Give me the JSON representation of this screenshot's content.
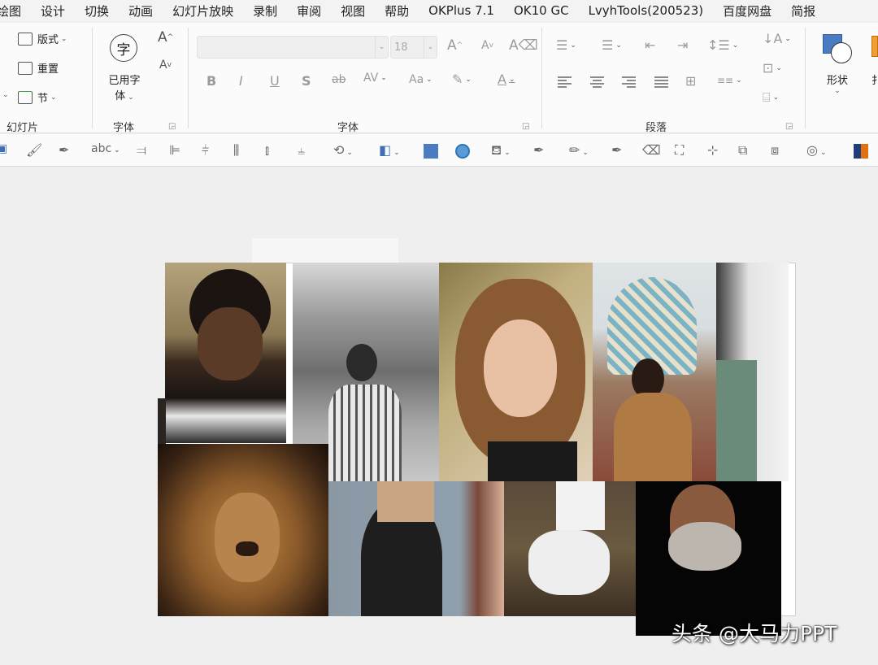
{
  "menu": {
    "tabs": [
      "绘图",
      "设计",
      "切换",
      "动画",
      "幻灯片放映",
      "录制",
      "审阅",
      "视图",
      "帮助",
      "OKPlus 7.1",
      "OK10 GC",
      "LvyhTools(200523)",
      "百度网盘",
      "简报"
    ]
  },
  "ribbon": {
    "slides_group": {
      "layout_label": "版式",
      "reset_label": "重置",
      "section_label": "节",
      "group_label": "幻灯片"
    },
    "font_embed_group": {
      "icon_char": "字",
      "button_label_line1": "已用字",
      "button_label_line2": "体",
      "group_label": "字体"
    },
    "font_group": {
      "font_name_value": "",
      "font_size_value": "18",
      "group_label": "字体"
    },
    "paragraph_group": {
      "group_label": "段落"
    },
    "shape_group": {
      "shape_label": "形状",
      "next_label_partial": "扌"
    }
  },
  "colors": {
    "accent_blue": "#3f6eb5",
    "shape_fill": "#4a7cc0",
    "circle_fill": "#5b9bd5"
  },
  "watermark": {
    "text": "头条 @大马力PPT"
  }
}
